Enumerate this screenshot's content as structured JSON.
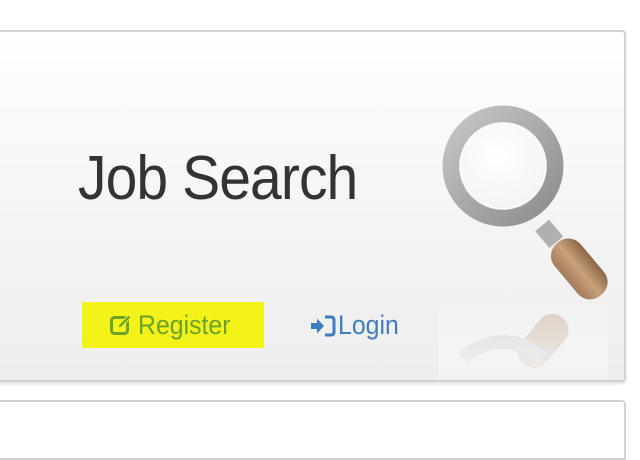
{
  "header": {
    "title": "Job Search",
    "logo_icon": "magnifying-glass-icon"
  },
  "nav": {
    "register": {
      "label": "Register",
      "icon": "edit-icon",
      "color": "#6aa22b",
      "highlight": "#f3f31a"
    },
    "login": {
      "label": "Login",
      "icon": "sign-in-icon",
      "color": "#3e7ec0"
    }
  }
}
